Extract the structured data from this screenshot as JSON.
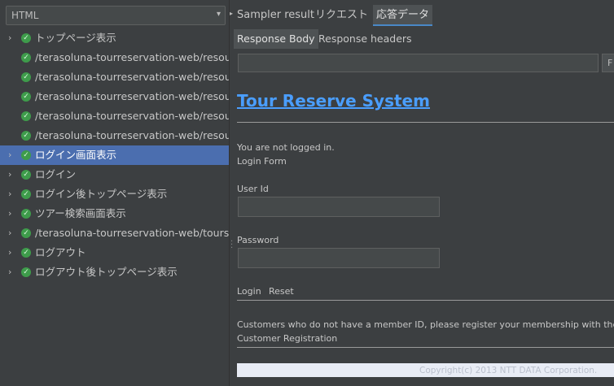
{
  "filter": {
    "value": "HTML",
    "arrow": "▾"
  },
  "tree": [
    {
      "label": "トップページ表示",
      "expandable": true,
      "selected": false,
      "indent": 0
    },
    {
      "label": "/terasoluna-tourreservation-web/resour",
      "expandable": false,
      "selected": false,
      "indent": 1
    },
    {
      "label": "/terasoluna-tourreservation-web/resour",
      "expandable": false,
      "selected": false,
      "indent": 1
    },
    {
      "label": "/terasoluna-tourreservation-web/resour",
      "expandable": false,
      "selected": false,
      "indent": 1
    },
    {
      "label": "/terasoluna-tourreservation-web/resour",
      "expandable": false,
      "selected": false,
      "indent": 1
    },
    {
      "label": "/terasoluna-tourreservation-web/resour",
      "expandable": false,
      "selected": false,
      "indent": 1
    },
    {
      "label": "ログイン画面表示",
      "expandable": true,
      "selected": true,
      "indent": 0
    },
    {
      "label": "ログイン",
      "expandable": true,
      "selected": false,
      "indent": 0
    },
    {
      "label": "ログイン後トップページ表示",
      "expandable": true,
      "selected": false,
      "indent": 0
    },
    {
      "label": "ツアー検索画面表示",
      "expandable": true,
      "selected": false,
      "indent": 0
    },
    {
      "label": "/terasoluna-tourreservation-web/tours-",
      "expandable": true,
      "selected": false,
      "indent": 0
    },
    {
      "label": "ログアウト",
      "expandable": true,
      "selected": false,
      "indent": 0
    },
    {
      "label": "ログアウト後トップページ表示",
      "expandable": true,
      "selected": false,
      "indent": 0
    }
  ],
  "tabs": {
    "sampler_result": "Sampler result",
    "request": "リクエスト",
    "response_data": "応答データ"
  },
  "subtabs": {
    "response_body": "Response Body",
    "response_headers": "Response headers"
  },
  "search": {
    "value": "",
    "button": "F"
  },
  "page": {
    "title": "Tour Reserve System",
    "not_logged_in": "You are not logged in.",
    "login_form": "Login Form",
    "user_id_label": "User Id",
    "password_label": "Password",
    "login_link": "Login",
    "reset_link": "Reset",
    "customers_text": "Customers who do not have a member ID, please register your membership with the bu",
    "customer_registration": "Customer Registration",
    "copyright": "Copyright(c) 2013 NTT DATA Corporation."
  },
  "colors": {
    "background": "#3c3f41",
    "selection": "#4b6eaf",
    "success_check": "#3e9c4b",
    "link": "#4a9eff"
  }
}
